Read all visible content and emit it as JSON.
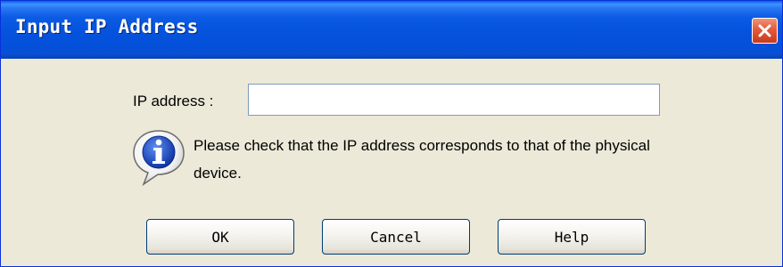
{
  "window": {
    "title": "Input IP Address",
    "close_icon": "close-icon"
  },
  "form": {
    "ip_label": "IP address :",
    "ip_value": "",
    "ip_placeholder": ""
  },
  "info": {
    "icon": "info-icon",
    "message": "Please check that the IP address corresponds to that of the physical device."
  },
  "buttons": {
    "ok": "OK",
    "cancel": "Cancel",
    "help": "Help"
  },
  "colors": {
    "titlebar": "#0552dd",
    "dialog_background": "#ece9d8",
    "close_button": "#e25a3c",
    "button_border": "#003c74",
    "input_border": "#7f9db9"
  }
}
